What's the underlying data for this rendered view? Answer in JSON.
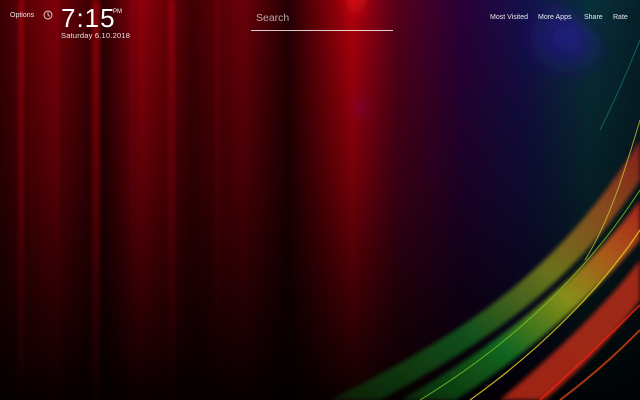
{
  "header": {
    "options_label": "Options",
    "clock_icon": "clock-icon"
  },
  "clock": {
    "time": "7:15",
    "period": "PM",
    "date": "Saturday  6.10.2018"
  },
  "search": {
    "placeholder": "Search",
    "value": ""
  },
  "nav": {
    "most_visited": "Most Visited",
    "more_apps": "More Apps",
    "share": "Share",
    "rate": "Rate"
  },
  "wallpaper": {
    "colors": [
      "#b0000a",
      "#ff1a1a",
      "#8a0a6a",
      "#2a0a8a",
      "#1a8a2a",
      "#d8d81a",
      "#ff6a1a"
    ]
  }
}
